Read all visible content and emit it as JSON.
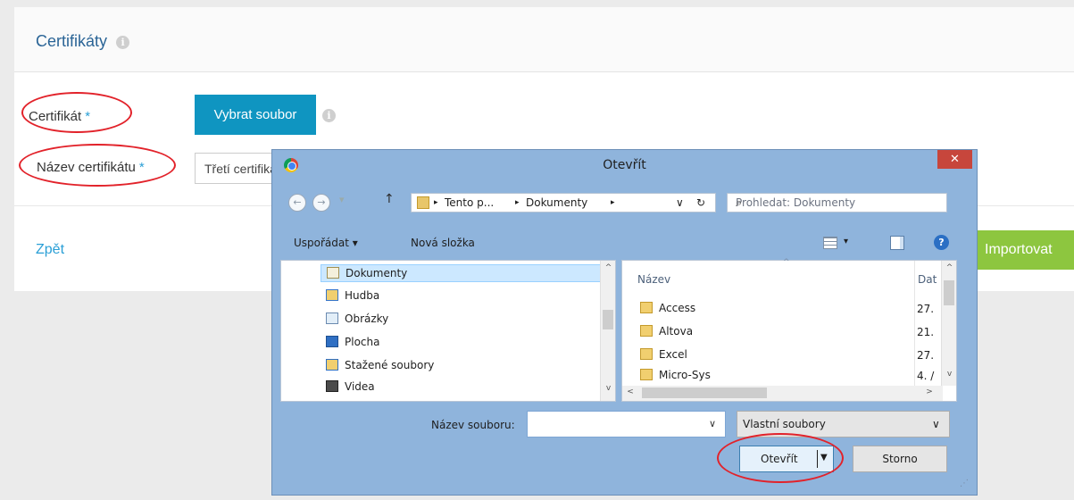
{
  "page": {
    "title": "Certifikáty",
    "certificate_label": "Certifikát",
    "required_mark": "*",
    "choose_file_button": "Vybrat soubor",
    "name_label": "Název certifikátu",
    "name_value": "Třetí certifikát",
    "back_link": "Zpět",
    "import_button": "Importovat",
    "info_glyph": "i"
  },
  "dialog": {
    "title": "Otevřít",
    "close_glyph": "✕",
    "nav": {
      "back_glyph": "←",
      "forward_glyph": "→",
      "recent_glyph": "▾",
      "up_glyph": "↑",
      "crumb_sep": "▸",
      "breadcrumb": [
        "Tento p...",
        "Dokumenty"
      ],
      "addr_dropdown": "∨",
      "refresh_glyph": "↻",
      "search_placeholder": "Prohledat: Dokumenty",
      "search_glyph": "⌕"
    },
    "toolbar": {
      "organize": "Uspořádat ▾",
      "new_folder": "Nová složka",
      "view_dropdown": "▾",
      "help_glyph": "?"
    },
    "tree": [
      {
        "label": "Dokumenty",
        "icon": "documents-icon",
        "selected": true
      },
      {
        "label": "Hudba",
        "icon": "music-icon"
      },
      {
        "label": "Obrázky",
        "icon": "pictures-icon"
      },
      {
        "label": "Plocha",
        "icon": "desktop-icon"
      },
      {
        "label": "Stažené soubory",
        "icon": "downloads-icon"
      },
      {
        "label": "Videa",
        "icon": "videos-icon"
      }
    ],
    "columns": {
      "name": "Název",
      "date": "Dat"
    },
    "files": [
      {
        "name": "Access",
        "date": "27."
      },
      {
        "name": "Altova",
        "date": "21."
      },
      {
        "name": "Excel",
        "date": "27."
      },
      {
        "name": "Micro-Sys",
        "date": "4. /"
      }
    ],
    "scroll": {
      "up": "^",
      "down": "v",
      "left": "<",
      "right": ">"
    },
    "filename_label": "Název souboru:",
    "filename_value": "",
    "filename_dropdown": "∨",
    "filetype": "Vlastní soubory",
    "filetype_dropdown": "∨",
    "open_button": "Otevřít",
    "open_dropdown": "▼",
    "cancel_button": "Storno",
    "resize_grip": "⋰"
  },
  "colors": {
    "accent_blue": "#0f95c1",
    "import_green": "#8dc63f",
    "annotation_red": "#e2222a",
    "dialog_frame": "#8fb4dc",
    "close_red": "#c7463c"
  }
}
